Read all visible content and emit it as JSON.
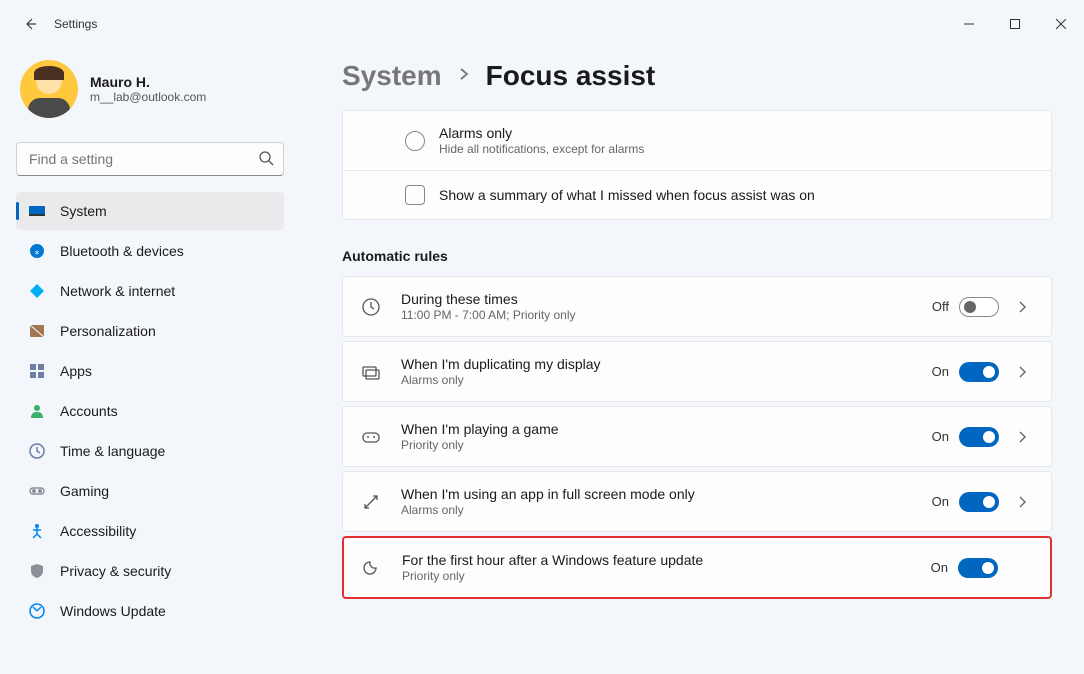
{
  "app_title": "Settings",
  "user": {
    "name": "Mauro H.",
    "email": "m__lab@outlook.com"
  },
  "search": {
    "placeholder": "Find a setting"
  },
  "sidebar": {
    "items": [
      {
        "label": "System",
        "color": "#0067c0",
        "active": true
      },
      {
        "label": "Bluetooth & devices",
        "color": "#0067c0"
      },
      {
        "label": "Network & internet",
        "color": "#0086f0"
      },
      {
        "label": "Personalization",
        "color": "#a37551"
      },
      {
        "label": "Apps",
        "color": "#6b7ea3"
      },
      {
        "label": "Accounts",
        "color": "#3aaf6a"
      },
      {
        "label": "Time & language",
        "color": "#6b7ea3"
      },
      {
        "label": "Gaming",
        "color": "#8a9298"
      },
      {
        "label": "Accessibility",
        "color": "#0086f0"
      },
      {
        "label": "Privacy & security",
        "color": "#8a9298"
      },
      {
        "label": "Windows Update",
        "color": "#0086f0"
      }
    ]
  },
  "breadcrumb": {
    "parent": "System",
    "current": "Focus assist"
  },
  "focus_options": {
    "alarms_only": {
      "title": "Alarms only",
      "sub": "Hide all notifications, except for alarms"
    },
    "summary_label": "Show a summary of what I missed when focus assist was on"
  },
  "rules_header": "Automatic rules",
  "rules": [
    {
      "title": "During these times",
      "sub": "11:00 PM - 7:00 AM; Priority only",
      "state": "Off",
      "on": false,
      "chevron": true
    },
    {
      "title": "When I'm duplicating my display",
      "sub": "Alarms only",
      "state": "On",
      "on": true,
      "chevron": true
    },
    {
      "title": "When I'm playing a game",
      "sub": "Priority only",
      "state": "On",
      "on": true,
      "chevron": true
    },
    {
      "title": "When I'm using an app in full screen mode only",
      "sub": "Alarms only",
      "state": "On",
      "on": true,
      "chevron": true
    },
    {
      "title": "For the first hour after a Windows feature update",
      "sub": "Priority only",
      "state": "On",
      "on": true,
      "chevron": false,
      "highlight": true
    }
  ]
}
